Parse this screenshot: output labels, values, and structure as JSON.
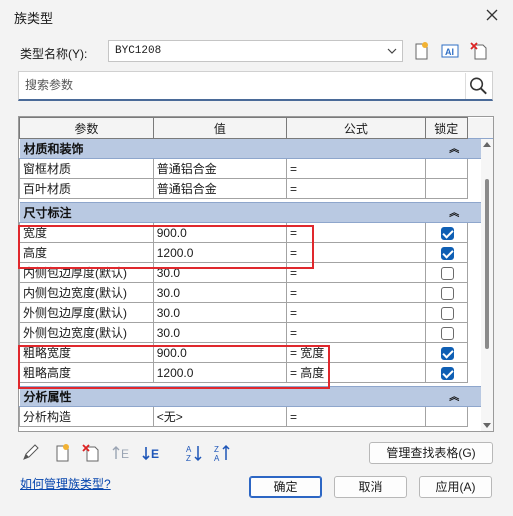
{
  "window": {
    "title": "族类型"
  },
  "type_name": {
    "label": "类型名称(Y):",
    "value": "BYC1208"
  },
  "search": {
    "placeholder": "搜索参数"
  },
  "columns": {
    "param": "参数",
    "value": "值",
    "formula": "公式",
    "lock": "锁定"
  },
  "groups": {
    "materials": "材质和装饰",
    "dimensions": "尺寸标注",
    "analysis": "分析属性"
  },
  "rows": {
    "frame_material": {
      "param": "窗框材质",
      "value": "普通铝合金",
      "formula": "="
    },
    "louver_material": {
      "param": "百叶材质",
      "value": "普通铝合金",
      "formula": "="
    },
    "width": {
      "param": "宽度",
      "value": "900.0",
      "formula": "=",
      "locked": true
    },
    "height": {
      "param": "高度",
      "value": "1200.0",
      "formula": "=",
      "locked": true
    },
    "inner_trim_thickness": {
      "param": "内侧包边厚度(默认)",
      "value": "30.0",
      "formula": "=",
      "locked": false
    },
    "inner_trim_width": {
      "param": "内侧包边宽度(默认)",
      "value": "30.0",
      "formula": "=",
      "locked": false
    },
    "outer_trim_thickness": {
      "param": "外侧包边厚度(默认)",
      "value": "30.0",
      "formula": "=",
      "locked": false
    },
    "outer_trim_width": {
      "param": "外侧包边宽度(默认)",
      "value": "30.0",
      "formula": "=",
      "locked": false
    },
    "rough_width": {
      "param": "粗略宽度",
      "value": "900.0",
      "formula": "= 宽度",
      "locked": true
    },
    "rough_height": {
      "param": "粗略高度",
      "value": "1200.0",
      "formula": "= 高度",
      "locked": true
    },
    "analytic_construction": {
      "param": "分析构造",
      "value": "<无>",
      "formula": "="
    }
  },
  "buttons": {
    "manage_lookup": "管理查找表格(G)",
    "ok": "确定",
    "cancel": "取消",
    "apply": "应用(A)"
  },
  "help_link": "如何管理族类型?",
  "colors": {
    "group_header": "#b9c9e2",
    "highlight": "#e0282d",
    "check": "#0f5fb4"
  }
}
